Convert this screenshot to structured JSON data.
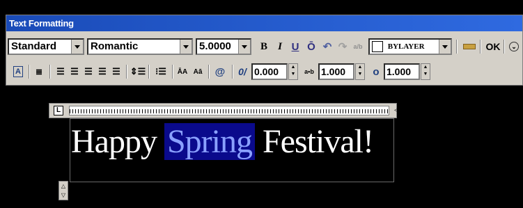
{
  "window": {
    "title": "Text Formatting"
  },
  "row1": {
    "style": "Standard",
    "font": "Romantic",
    "height": "5.0000",
    "bold": "B",
    "italic": "I",
    "underline": "U",
    "overline": "Ō",
    "undo": "↶",
    "redo": "↷",
    "stack": "a/b",
    "color": "BYLAYER",
    "ok": "OK"
  },
  "row2": {
    "oblique_angle": "0.000",
    "tracking": "1.000",
    "width_factor": "1.000",
    "case_upper": "ĀA",
    "case_lower": "Aā",
    "symbol": "@",
    "oblique_label": "0/",
    "tracking_label": "a•b",
    "width_label": "o"
  },
  "ruler": {
    "indent_label": "L"
  },
  "editor": {
    "text_before": "Happy ",
    "selected": "Spring",
    "text_after": " Festival!"
  },
  "colors": {
    "titlebar": "#1a4bb8",
    "selection_bg": "#0a0a8c",
    "selection_fg": "#8aa0ff",
    "canvas": "#000000"
  }
}
